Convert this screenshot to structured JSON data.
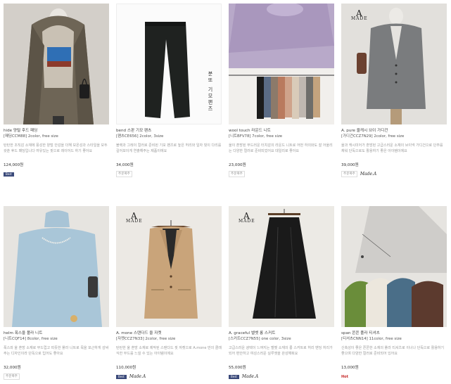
{
  "products": [
    {
      "name": "hide 양털 후드 패딩",
      "code": "[패딩CCM88] 2color, free size",
      "desc": "탄탄한 조직감 소재에 풍성한 양털 안감을 더해 보온성과 스타일을 모두 갖춘 후드 패딩입니다 여유있는 핏으로 레이어드 하기 좋아요",
      "price": "124,000원",
      "badges": [
        "Best",
        ""
      ]
    },
    {
      "name": "bend 스판 기모 팬츠",
      "code": "[팬츠CE656] 2color, 3size",
      "desc": "블랙과 그레이 컬러로 준비된 기모 팬츠로 높은 허리와 일자 핏이 다리를 길어보이게 연출해주는 제품이에요",
      "price": "34,000원",
      "badges": [
        "주문폭주"
      ],
      "overlay_text": "분또 기모팬츠"
    },
    {
      "name": "wool touch 라운드 니트",
      "code": "[니트BFV78] 7color, free size",
      "desc": "울이 혼방된 부드러운 터치감의 라운드 니트로 어떤 하의와도 잘 어울리는 다양한 컬러로 준비되었어요 데일리로 좋아요",
      "price": "23,000원",
      "badges": [
        "주문폭주"
      ]
    },
    {
      "name": "A. pure 울캐시 브이 가디건",
      "code": "[가디건CCZ7N29] 2color, free size",
      "desc": "울과 캐시미어가 혼방된 고급스러운 소재의 브이넥 가디건으로 단추를 채워 단독으로도 활용하기 좋은 아이템이에요",
      "price": "39,000원",
      "badges": [
        "주문폭주",
        "Made.A"
      ],
      "logo": "A MADE"
    },
    {
      "name": "helm 폭스울 폴라 니트",
      "code": "[니트CQF14] 8color, free size",
      "desc": "폭스와 울 혼방 소재로 부드럽고 따뜻한 폴라 니트로 목을 포근하게 감싸주는 디자인이라 단독으로 입어도 좋아요",
      "price": "32,000원",
      "badges": [
        "주문폭주"
      ]
    },
    {
      "name": "A. mone 스탠다드 울 자켓",
      "code": "[자켓CCZ7N33] 2color, free size",
      "desc": "탄탄한 울 혼방 소재로 제작된 스탠다드 핏 자켓으로 A.mone 만의 클래식한 무드를 느낄 수 있는 아이템이에요",
      "price": "110,000원",
      "badges": [
        "Best",
        "Made.A"
      ],
      "logo": "A MADE"
    },
    {
      "name": "A. graceful 벨벳 롱 스커트",
      "code": "[스커트CCZ7N55] one color, 3size",
      "desc": "고급스러운 광택이 느껴지는 벨벳 소재의 롱 스커트로 허리 밴딩 처리가 되어 편안하고 여성스러운 실루엣을 완성해줘요",
      "price": "55,000원",
      "badges": [
        "Best",
        "Made.A"
      ],
      "logo": "A MADE"
    },
    {
      "name": "span 쫀쫀 폴라 티셔츠",
      "code": "[티셔츠CNN14] 11color, free size",
      "desc": "신축성이 좋은 쫀쫀한 소재의 폴라 티셔츠로 이너나 단독으로 활용하기 좋으며 다양한 컬러로 준비되어 있어요",
      "price": "13,000원",
      "badges": [
        "Hot"
      ]
    }
  ],
  "colors": {
    "best_badge": "#3b4a7a",
    "hot_badge": "#c62828"
  }
}
